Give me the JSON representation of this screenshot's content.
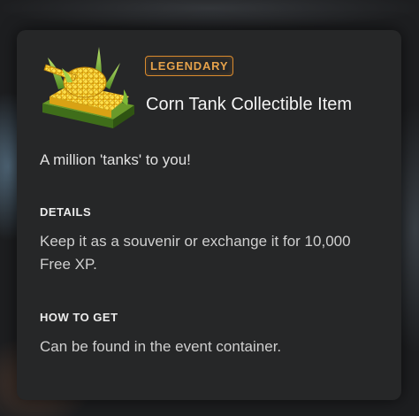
{
  "item": {
    "rarity": "LEGENDARY",
    "title": "Corn Tank Collectible Item",
    "description": "A million 'tanks' to you!",
    "image_icon": "corn-tank-icon"
  },
  "details": {
    "heading": "DETAILS",
    "text": "Keep it as a souvenir or exchange it for 10,000 Free XP."
  },
  "how_to_get": {
    "heading": "HOW TO GET",
    "text": "Can be found in the event container."
  },
  "colors": {
    "card_background": "#262728",
    "legendary_accent": "#d98a2e",
    "corn_yellow": "#f2c21a",
    "husk_green": "#6fae2f"
  }
}
